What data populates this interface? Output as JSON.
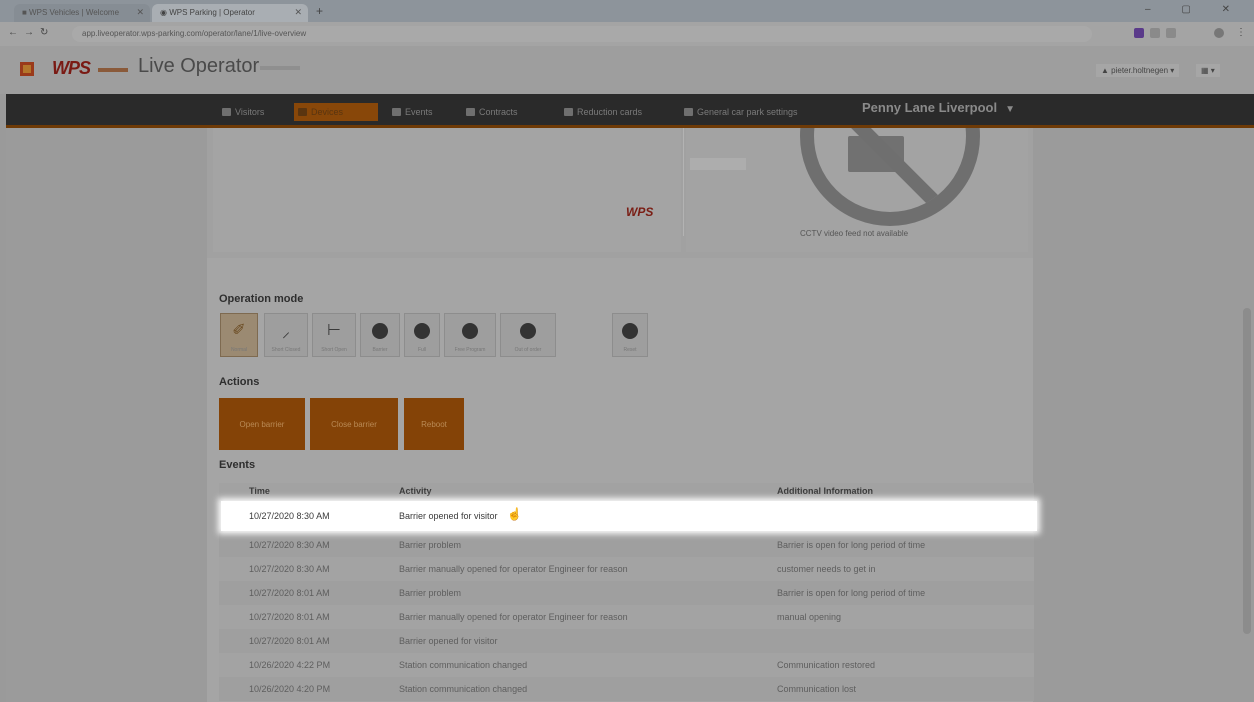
{
  "browser": {
    "tabs": [
      {
        "label": "■ WPS Vehicles | Welcome"
      },
      {
        "label": "◉ WPS Parking | Operator"
      }
    ],
    "new_tab": "+",
    "url": "app.liveoperator.wps-parking.com/operator/lane/1/live-overview",
    "window_controls": "–  ▢  ✕"
  },
  "app": {
    "logo": "WPS",
    "title": "Live Operator",
    "user_menu": "▲ pieter.holtnegen ▾",
    "lang_menu": "▦ ▾"
  },
  "nav": {
    "items": [
      {
        "label": "Visitors"
      },
      {
        "label": "Devices"
      },
      {
        "label": "Events"
      },
      {
        "label": "Contracts"
      },
      {
        "label": "Reduction cards"
      },
      {
        "label": "General car park settings"
      }
    ],
    "location": "Penny Lane Liverpool",
    "location_icon": "▼"
  },
  "preview": {
    "cctv_text": "CCTV video feed not available",
    "map_logo": "WPS"
  },
  "operation_mode": {
    "title": "Operation mode",
    "modes": [
      {
        "glyph": "✐",
        "label": "Normal",
        "icon": "normal-mode-icon"
      },
      {
        "glyph": "⸝",
        "label": "Short Closed",
        "icon": "short-closed-icon"
      },
      {
        "glyph": "⊢",
        "label": "Short Open",
        "icon": "short-open-icon"
      },
      {
        "glyph": "",
        "label": "Barrier",
        "icon": "barrier-icon"
      },
      {
        "glyph": "",
        "label": "Full",
        "icon": "full-icon"
      },
      {
        "glyph": "",
        "label": "Free Program",
        "icon": "free-program-icon"
      },
      {
        "glyph": "",
        "label": "Out of order",
        "icon": "out-of-order-icon"
      },
      {
        "glyph": "",
        "label": "Reset",
        "icon": "reset-icon"
      }
    ]
  },
  "actions": {
    "title": "Actions",
    "open_barrier": "Open barrier",
    "close_barrier": "Close barrier",
    "reboot": "Reboot"
  },
  "events": {
    "title": "Events",
    "columns": [
      "Time",
      "Activity",
      "Additional Information"
    ],
    "highlighted": {
      "time": "10/27/2020 8:30 AM",
      "activity": "Barrier opened for visitor",
      "info": ""
    },
    "rows": [
      {
        "time": "10/27/2020 8:30 AM",
        "activity": "Barrier problem",
        "info": "Barrier is open for long period of time"
      },
      {
        "time": "10/27/2020 8:30 AM",
        "activity": "Barrier manually opened for operator Engineer for reason",
        "info": "customer needs to get in"
      },
      {
        "time": "10/27/2020 8:01 AM",
        "activity": "Barrier problem",
        "info": "Barrier is open for long period of time"
      },
      {
        "time": "10/27/2020 8:01 AM",
        "activity": "Barrier manually opened for operator Engineer for reason",
        "info": "manual opening"
      },
      {
        "time": "10/27/2020 8:01 AM",
        "activity": "Barrier opened for visitor",
        "info": ""
      },
      {
        "time": "10/26/2020 4:22 PM",
        "activity": "Station communication changed",
        "info": "Communication restored"
      },
      {
        "time": "10/26/2020 4:20 PM",
        "activity": "Station communication changed",
        "info": "Communication lost"
      }
    ]
  },
  "colors": {
    "accent": "#844307",
    "navbar": "#2a2a2a",
    "highlight": "#ffffff"
  }
}
